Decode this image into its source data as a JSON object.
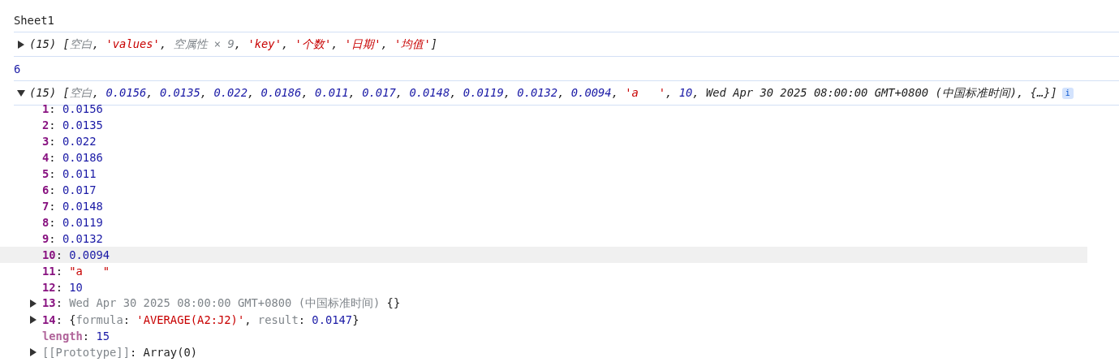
{
  "console": {
    "messages": [
      {
        "kind": "text",
        "tokens": [
          {
            "text": "Sheet1",
            "kind": "plain"
          }
        ]
      },
      {
        "kind": "object",
        "expanded": false,
        "tokens": [
          {
            "text": "(15) [",
            "kind": "plain"
          },
          {
            "text": "空白",
            "kind": "gray"
          },
          {
            "text": ", ",
            "kind": "plain"
          },
          {
            "text": "'values'",
            "kind": "str"
          },
          {
            "text": ", ",
            "kind": "plain"
          },
          {
            "text": "空属性 × 9",
            "kind": "gray"
          },
          {
            "text": ", ",
            "kind": "plain"
          },
          {
            "text": "'key'",
            "kind": "str"
          },
          {
            "text": ", ",
            "kind": "plain"
          },
          {
            "text": "'个数'",
            "kind": "str"
          },
          {
            "text": ", ",
            "kind": "plain"
          },
          {
            "text": "'日期'",
            "kind": "str"
          },
          {
            "text": ", ",
            "kind": "plain"
          },
          {
            "text": "'均值'",
            "kind": "str"
          },
          {
            "text": "]",
            "kind": "plain"
          }
        ]
      },
      {
        "kind": "text",
        "tokens": [
          {
            "text": "6",
            "kind": "num"
          }
        ]
      },
      {
        "kind": "object",
        "expanded": true,
        "badge": "i",
        "tokens": [
          {
            "text": "(15) [",
            "kind": "plain"
          },
          {
            "text": "空白",
            "kind": "gray"
          },
          {
            "text": ", ",
            "kind": "plain"
          },
          {
            "text": "0.0156",
            "kind": "num"
          },
          {
            "text": ", ",
            "kind": "plain"
          },
          {
            "text": "0.0135",
            "kind": "num"
          },
          {
            "text": ", ",
            "kind": "plain"
          },
          {
            "text": "0.022",
            "kind": "num"
          },
          {
            "text": ", ",
            "kind": "plain"
          },
          {
            "text": "0.0186",
            "kind": "num"
          },
          {
            "text": ", ",
            "kind": "plain"
          },
          {
            "text": "0.011",
            "kind": "num"
          },
          {
            "text": ", ",
            "kind": "plain"
          },
          {
            "text": "0.017",
            "kind": "num"
          },
          {
            "text": ", ",
            "kind": "plain"
          },
          {
            "text": "0.0148",
            "kind": "num"
          },
          {
            "text": ", ",
            "kind": "plain"
          },
          {
            "text": "0.0119",
            "kind": "num"
          },
          {
            "text": ", ",
            "kind": "plain"
          },
          {
            "text": "0.0132",
            "kind": "num"
          },
          {
            "text": ", ",
            "kind": "plain"
          },
          {
            "text": "0.0094",
            "kind": "num"
          },
          {
            "text": ", ",
            "kind": "plain"
          },
          {
            "text": "'a   '",
            "kind": "str"
          },
          {
            "text": ", ",
            "kind": "plain"
          },
          {
            "text": "10",
            "kind": "num"
          },
          {
            "text": ", Wed Apr 30 2025 08:00:00 GMT+0800 (中国标准时间), {…}]",
            "kind": "plain"
          }
        ],
        "children": [
          {
            "kind": "leaf",
            "selected": false,
            "tokens": [
              {
                "text": "1",
                "kind": "index"
              },
              {
                "text": ": ",
                "kind": "plain"
              },
              {
                "text": "0.0156",
                "kind": "num"
              }
            ]
          },
          {
            "kind": "leaf",
            "selected": false,
            "tokens": [
              {
                "text": "2",
                "kind": "index"
              },
              {
                "text": ": ",
                "kind": "plain"
              },
              {
                "text": "0.0135",
                "kind": "num"
              }
            ]
          },
          {
            "kind": "leaf",
            "selected": false,
            "tokens": [
              {
                "text": "3",
                "kind": "index"
              },
              {
                "text": ": ",
                "kind": "plain"
              },
              {
                "text": "0.022",
                "kind": "num"
              }
            ]
          },
          {
            "kind": "leaf",
            "selected": false,
            "tokens": [
              {
                "text": "4",
                "kind": "index"
              },
              {
                "text": ": ",
                "kind": "plain"
              },
              {
                "text": "0.0186",
                "kind": "num"
              }
            ]
          },
          {
            "kind": "leaf",
            "selected": false,
            "tokens": [
              {
                "text": "5",
                "kind": "index"
              },
              {
                "text": ": ",
                "kind": "plain"
              },
              {
                "text": "0.011",
                "kind": "num"
              }
            ]
          },
          {
            "kind": "leaf",
            "selected": false,
            "tokens": [
              {
                "text": "6",
                "kind": "index"
              },
              {
                "text": ": ",
                "kind": "plain"
              },
              {
                "text": "0.017",
                "kind": "num"
              }
            ]
          },
          {
            "kind": "leaf",
            "selected": false,
            "tokens": [
              {
                "text": "7",
                "kind": "index"
              },
              {
                "text": ": ",
                "kind": "plain"
              },
              {
                "text": "0.0148",
                "kind": "num"
              }
            ]
          },
          {
            "kind": "leaf",
            "selected": false,
            "tokens": [
              {
                "text": "8",
                "kind": "index"
              },
              {
                "text": ": ",
                "kind": "plain"
              },
              {
                "text": "0.0119",
                "kind": "num"
              }
            ]
          },
          {
            "kind": "leaf",
            "selected": false,
            "tokens": [
              {
                "text": "9",
                "kind": "index"
              },
              {
                "text": ": ",
                "kind": "plain"
              },
              {
                "text": "0.0132",
                "kind": "num"
              }
            ]
          },
          {
            "kind": "leaf",
            "selected": true,
            "tokens": [
              {
                "text": "10",
                "kind": "index"
              },
              {
                "text": ": ",
                "kind": "plain"
              },
              {
                "text": "0.0094",
                "kind": "num"
              }
            ]
          },
          {
            "kind": "leaf",
            "selected": false,
            "tokens": [
              {
                "text": "11",
                "kind": "index"
              },
              {
                "text": ": ",
                "kind": "plain"
              },
              {
                "text": "\"a   \"",
                "kind": "str"
              }
            ]
          },
          {
            "kind": "leaf",
            "selected": false,
            "tokens": [
              {
                "text": "12",
                "kind": "index"
              },
              {
                "text": ": ",
                "kind": "plain"
              },
              {
                "text": "10",
                "kind": "num"
              }
            ]
          },
          {
            "kind": "node",
            "expanded": false,
            "selected": false,
            "tokens": [
              {
                "text": "13",
                "kind": "index"
              },
              {
                "text": ": ",
                "kind": "plain"
              },
              {
                "text": "Wed Apr 30 2025 08:00:00 GMT+0800 (中国标准时间)",
                "kind": "gray"
              },
              {
                "text": " {}",
                "kind": "plain"
              }
            ]
          },
          {
            "kind": "node",
            "expanded": false,
            "selected": false,
            "tokens": [
              {
                "text": "14",
                "kind": "index"
              },
              {
                "text": ": {",
                "kind": "plain"
              },
              {
                "text": "formula",
                "kind": "gray"
              },
              {
                "text": ": ",
                "kind": "plain"
              },
              {
                "text": "'AVERAGE(A2:J2)'",
                "kind": "str"
              },
              {
                "text": ", ",
                "kind": "plain"
              },
              {
                "text": "result",
                "kind": "gray"
              },
              {
                "text": ": ",
                "kind": "plain"
              },
              {
                "text": "0.0147",
                "kind": "num"
              },
              {
                "text": "}",
                "kind": "plain"
              }
            ]
          },
          {
            "kind": "leaf",
            "selected": false,
            "tokens": [
              {
                "text": "length",
                "kind": "meta"
              },
              {
                "text": ": ",
                "kind": "plain"
              },
              {
                "text": "15",
                "kind": "num"
              }
            ]
          },
          {
            "kind": "node",
            "expanded": false,
            "selected": false,
            "tokens": [
              {
                "text": "[[Prototype]]",
                "kind": "gray"
              },
              {
                "text": ": ",
                "kind": "plain"
              },
              {
                "text": "Array(0)",
                "kind": "plain"
              }
            ]
          }
        ]
      }
    ]
  }
}
